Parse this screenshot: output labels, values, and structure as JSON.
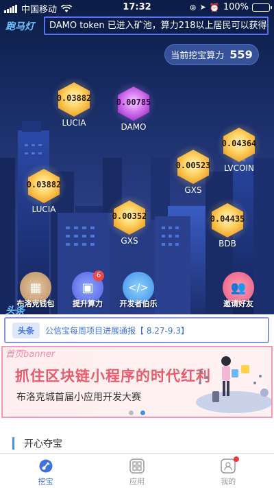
{
  "status_bar": {
    "carrier": "中国移动",
    "time": "17:32",
    "battery": "100%",
    "battery_level": 1.0
  },
  "marquee": {
    "tag": "跑马灯",
    "text": "DAMO token 已进入矿池，算力218以上居民可以获得!"
  },
  "mining_power": {
    "label": "当前挖宝算力",
    "value": "559"
  },
  "gems": [
    {
      "value": "0.03882",
      "name": "LUCIA",
      "color": "gold"
    },
    {
      "value": "0.00785",
      "name": "DAMO",
      "color": "purple"
    },
    {
      "value": "0.04364",
      "name": "LVCOIN",
      "color": "gold"
    },
    {
      "value": "0.00523",
      "name": "GXS",
      "color": "gold"
    },
    {
      "value": "0.03882",
      "name": "LUCIA",
      "color": "gold"
    },
    {
      "value": "0.00352",
      "name": "GXS",
      "color": "gold"
    },
    {
      "value": "0.04435",
      "name": "BDB",
      "color": "gold"
    }
  ],
  "actions": {
    "wallet": "布洛克钱包",
    "boost": "提升算力",
    "boost_badge": "6",
    "developer": "开发者伯乐",
    "invite": "邀请好友"
  },
  "section_mark": "头条",
  "news": {
    "tag": "头条",
    "text": "公信宝每周项目进展通报【 8.27-9.3】"
  },
  "banner": {
    "mark": "首页banner",
    "title": "抓住区块链小程序的时代红利",
    "subtitle": "布洛克城首届小应用开发大赛",
    "pages": 2,
    "active_page": 2
  },
  "treasure": {
    "title": "开心夺宝"
  },
  "tabs": {
    "mine": "挖宝",
    "apps": "应用",
    "me": "我的"
  },
  "colors": {
    "accent": "#3f72d8",
    "banner_title": "#e75b6b",
    "badge": "#ef4747"
  }
}
